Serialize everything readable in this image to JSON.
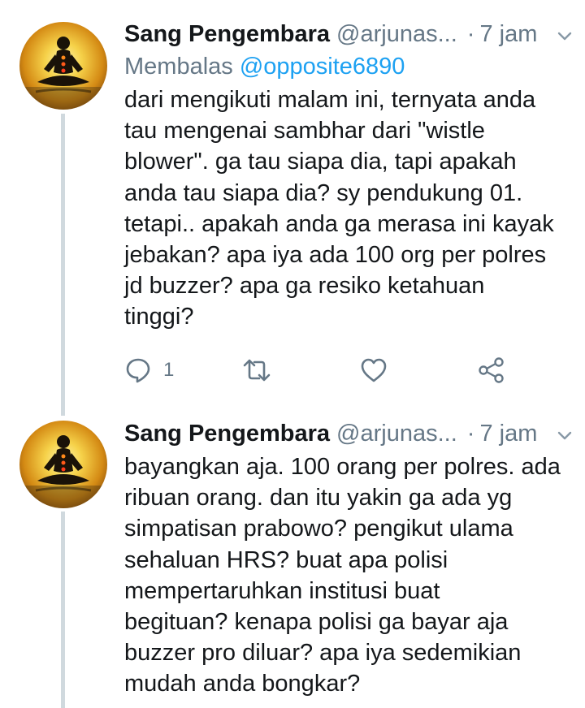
{
  "colors": {
    "text": "#14171a",
    "secondary": "#657786",
    "link": "#1da1f2",
    "thread_line": "#d0d9de"
  },
  "tweets": [
    {
      "author_name": "Sang Pengembara",
      "author_handle": "@arjunas...",
      "separator": "·",
      "time": "7 jam",
      "reply_prefix": "Membalas",
      "reply_mention": "@opposite6890",
      "text": "dari mengikuti malam ini, ternyata anda\ntau mengenai sambhar dari \"wistle\nblower\". ga tau siapa dia, tapi apakah\nanda tau siapa dia? sy pendukung 01.\ntetapi.. apakah anda ga merasa ini kayak\njebakan? apa iya ada 100 org per polres\njd buzzer? apa ga resiko ketahuan\ntinggi?",
      "reply_count": "1",
      "icons": [
        "reply-icon",
        "retweet-icon",
        "like-icon",
        "share-icon"
      ]
    },
    {
      "author_name": "Sang Pengembara",
      "author_handle": "@arjunas...",
      "separator": "·",
      "time": "7 jam",
      "text": "bayangkan aja. 100 orang per polres. ada\nribuan orang. dan itu yakin ga ada yg\nsimpatisan prabowo? pengikut ulama\nsehaluan HRS? buat apa polisi\nmempertaruhkan institusi buat\nbegituan? kenapa polisi ga bayar aja\nbuzzer pro diluar? apa iya sedemikian\nmudah anda bongkar?"
    }
  ]
}
